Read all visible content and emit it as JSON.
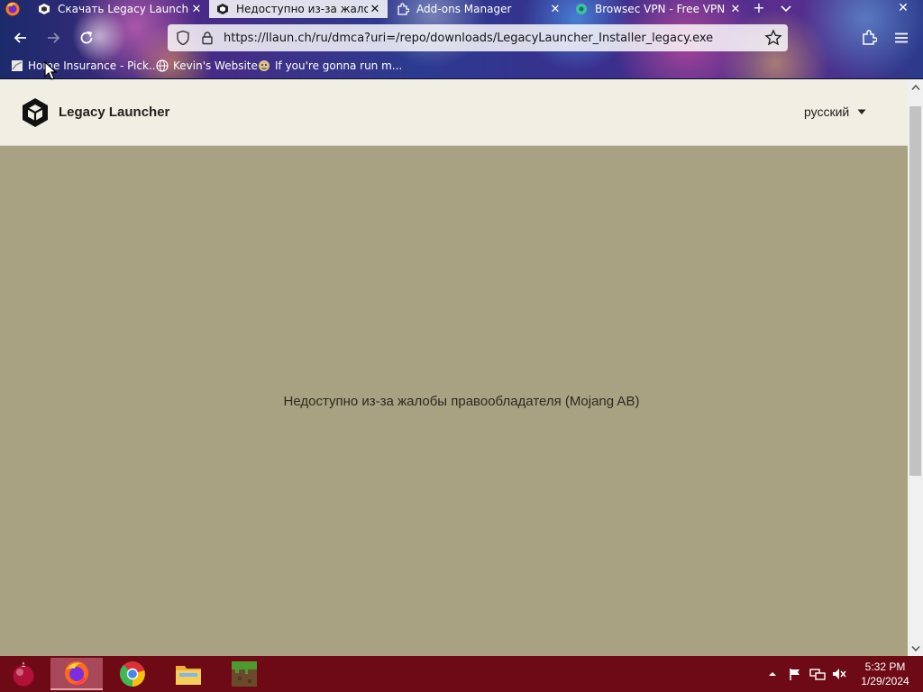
{
  "browser": {
    "tabs": [
      {
        "title": "Скачать Legacy Launcher",
        "active": false
      },
      {
        "title": "Недоступно из-за жалоб",
        "active": true
      },
      {
        "title": "Add-ons Manager",
        "active": false
      },
      {
        "title": "Browsec VPN - Free VPN",
        "active": false
      }
    ],
    "url_host": "https://llaun.ch",
    "url_path": "/ru/dmca?uri=/repo/downloads/LegacyLauncher_Installer_legacy.exe",
    "bookmarks": [
      {
        "label": "Home Insurance - Pick..."
      },
      {
        "label": "Kevin's Website"
      },
      {
        "label": "If you're gonna run m..."
      }
    ]
  },
  "site": {
    "brand": "Legacy Launcher",
    "language": "русский",
    "message": "Недоступно из-за жалобы правообладателя (Mojang AB)",
    "colors": {
      "header_bg": "#f1eee3",
      "page_bg": "#a9a282"
    }
  },
  "taskbar": {
    "apps": [
      {
        "name": "firefox-icon",
        "active": true
      },
      {
        "name": "chrome-icon",
        "active": false
      },
      {
        "name": "file-explorer-icon",
        "active": false
      },
      {
        "name": "minecraft-icon",
        "active": false
      }
    ],
    "time": "5:32 PM",
    "date": "1/29/2024",
    "colors": {
      "bg": "#6e0a16"
    }
  }
}
